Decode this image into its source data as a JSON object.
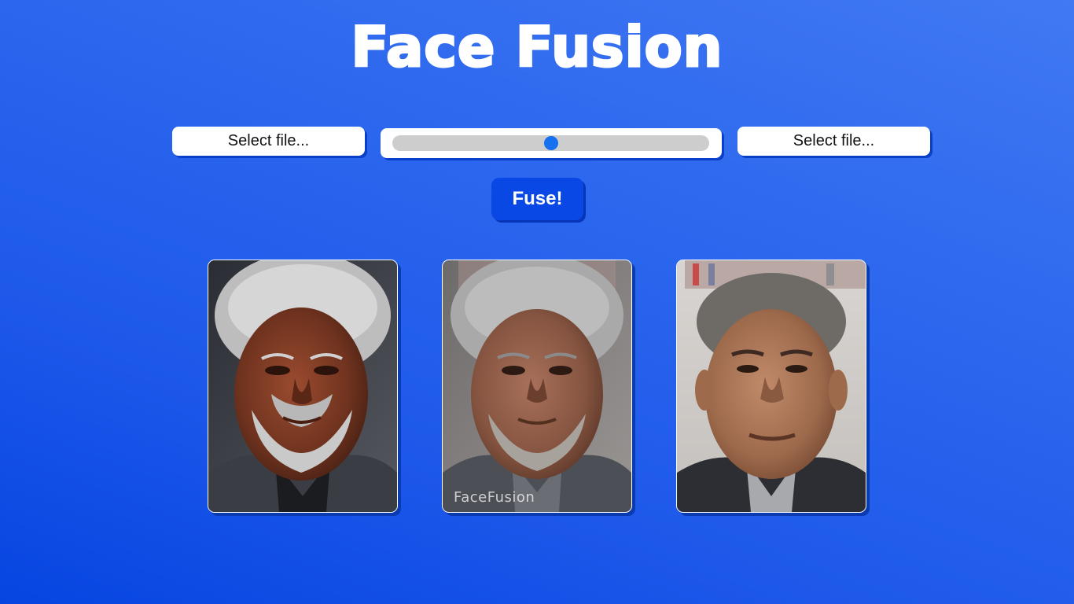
{
  "app": {
    "title": "Face Fusion"
  },
  "controls": {
    "left_file_label": "Select file...",
    "right_file_label": "Select file...",
    "blend_slider_value": 0.5,
    "fuse_label": "Fuse!"
  },
  "images": {
    "source_face_alt": "Source face portrait",
    "fused_face_alt": "Fused face result",
    "target_face_alt": "Target face portrait",
    "fused_watermark": "FaceFusion"
  },
  "colors": {
    "background_top": "#4179f3",
    "background_bottom": "#0745e1",
    "fuse_button": "#0a48e6",
    "slider_thumb": "#1670f0",
    "slider_track": "#cdcdcd"
  }
}
